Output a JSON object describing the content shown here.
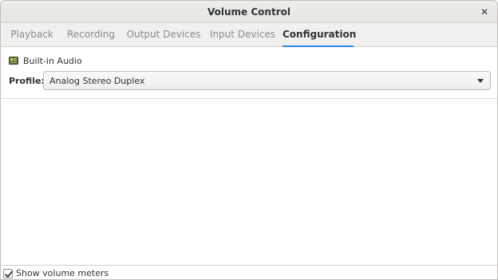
{
  "window": {
    "title": "Volume Control",
    "close_icon": "close-icon"
  },
  "tabs": [
    {
      "label": "Playback",
      "active": false
    },
    {
      "label": "Recording",
      "active": false
    },
    {
      "label": "Output Devices",
      "active": false
    },
    {
      "label": "Input Devices",
      "active": false
    },
    {
      "label": "Configuration",
      "active": true
    }
  ],
  "config": {
    "card_name": "Built-in Audio",
    "card_icon": "audio-card-icon",
    "profile_label": "Profile:",
    "profile_value": "Analog Stereo Duplex"
  },
  "footer": {
    "show_meters_label": "Show volume meters",
    "show_meters_checked": true
  },
  "colors": {
    "accent": "#3584e4",
    "text": "#2e3436",
    "inactive_tab": "#878d8f"
  }
}
